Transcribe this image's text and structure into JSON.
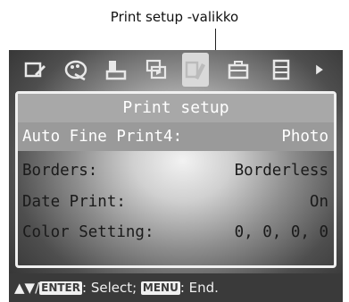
{
  "caption": "Print setup -valikko",
  "toolbar": {
    "icons": [
      {
        "name": "edit-icon"
      },
      {
        "name": "creative-icon"
      },
      {
        "name": "print-icon"
      },
      {
        "name": "slideshow-icon"
      },
      {
        "name": "print-setup-icon",
        "selected": true
      },
      {
        "name": "toolbox-icon"
      },
      {
        "name": "options-icon"
      },
      {
        "name": "scroll-right-icon"
      }
    ]
  },
  "panel": {
    "title": "Print setup",
    "rows": [
      {
        "label": "Auto Fine Print4:",
        "value": "Photo",
        "selected": true
      },
      {
        "label": "Borders:",
        "value": "Borderless"
      },
      {
        "label": "Date Print:",
        "value": "On"
      },
      {
        "label": "Color Setting:",
        "value": "0, 0, 0, 0"
      }
    ]
  },
  "statusbar": {
    "arrows": "▲▼/",
    "enter_key": "ENTER",
    "select_text": ": Select; ",
    "menu_key": "MENU",
    "end_text": ": End."
  }
}
